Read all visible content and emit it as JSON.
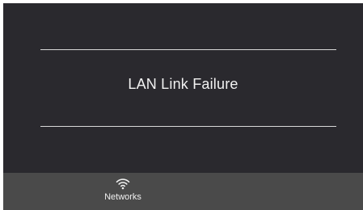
{
  "main": {
    "message": "LAN Link Failure"
  },
  "bottom_nav": {
    "items": [
      {
        "label": "Networks",
        "icon": "wifi-icon"
      }
    ]
  },
  "colors": {
    "background": "#2a292e",
    "nav_bar": "#4a4a4a",
    "text": "#f2f2f2",
    "divider": "#d9d9d9"
  }
}
